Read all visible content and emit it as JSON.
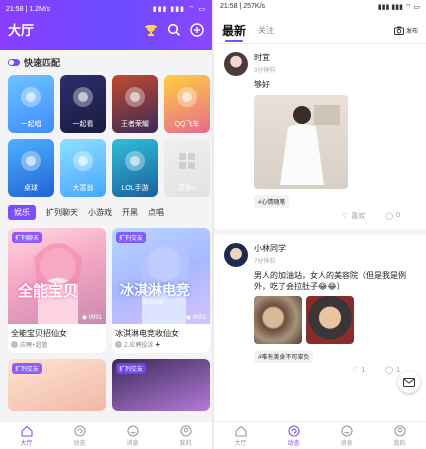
{
  "left": {
    "status": {
      "time": "21:58",
      "speed": "1.2M/s",
      "icons": "▮▮▮ ▮▮▮ ⌔ ▭"
    },
    "title": "大厅",
    "quick_match": {
      "label": "快速匹配"
    },
    "games": [
      {
        "label": "一起唱",
        "color1": "#6dc4ff",
        "color2": "#3f8bff"
      },
      {
        "label": "一起看",
        "color1": "#2b2f6a",
        "color2": "#1a1b40"
      },
      {
        "label": "王者荣耀",
        "color1": "#c24a2e",
        "color2": "#3a2a58"
      },
      {
        "label": "QQ飞车",
        "color1": "#ffcf3c",
        "color2": "#e86a8f"
      },
      {
        "label": "桌球",
        "color1": "#4fb1ff",
        "color2": "#2063d4"
      },
      {
        "label": "大富翁",
        "color1": "#8fe0ff",
        "color2": "#45a6ff"
      },
      {
        "label": "LOL手游",
        "color1": "#2fc0d8",
        "color2": "#1b5fa0"
      },
      {
        "label": "更多+",
        "color1": "#efefef",
        "color2": "#e2e2e2"
      }
    ],
    "tabs": [
      "娱乐",
      "扩列聊天",
      "小游戏",
      "开黑",
      "点唱"
    ],
    "cards": [
      {
        "badge": "扩列聊天",
        "title": "全能宝贝招仙女",
        "meta": "应聘+超管",
        "views": "9991",
        "overlay": "全能宝贝"
      },
      {
        "badge": "扩列交友",
        "title": "冰淇淋电竞收仙女",
        "meta": "Z.应聘投诉",
        "views": "9001",
        "overlay": "冰淇淋电竞",
        "sub": "ID:5522"
      }
    ],
    "cards_bottom": [
      {
        "badge": "扩列交友"
      },
      {
        "badge": "扩列交友"
      }
    ],
    "nav": [
      {
        "label": "大厅",
        "active": true
      },
      {
        "label": "动态",
        "active": false
      },
      {
        "label": "消息",
        "active": false
      },
      {
        "label": "我的",
        "active": false
      }
    ]
  },
  "right": {
    "status": {
      "time": "21:58",
      "speed": "257K/s",
      "icons": "▮▮▮ ▮▮▮ ⌔ ▭"
    },
    "tabs": {
      "latest": "最新",
      "follow": "关注"
    },
    "publish": "发布",
    "posts": [
      {
        "name": "时宜",
        "time": "3分钟前",
        "text": "够好",
        "tag": "#心情随笔",
        "likes": "喜欢",
        "comments": "0"
      },
      {
        "name": "小林同学",
        "time": "7分钟前",
        "text": "男人的加油站，女人的美容院（但是我是例外，吃了会拉肚子😂😂）",
        "tag": "#唯有美食不可辜负",
        "likes": "1",
        "comments": "1"
      }
    ],
    "nav": [
      {
        "label": "大厅",
        "active": false
      },
      {
        "label": "动态",
        "active": true
      },
      {
        "label": "消息",
        "active": false
      },
      {
        "label": "我的",
        "active": false
      }
    ]
  }
}
